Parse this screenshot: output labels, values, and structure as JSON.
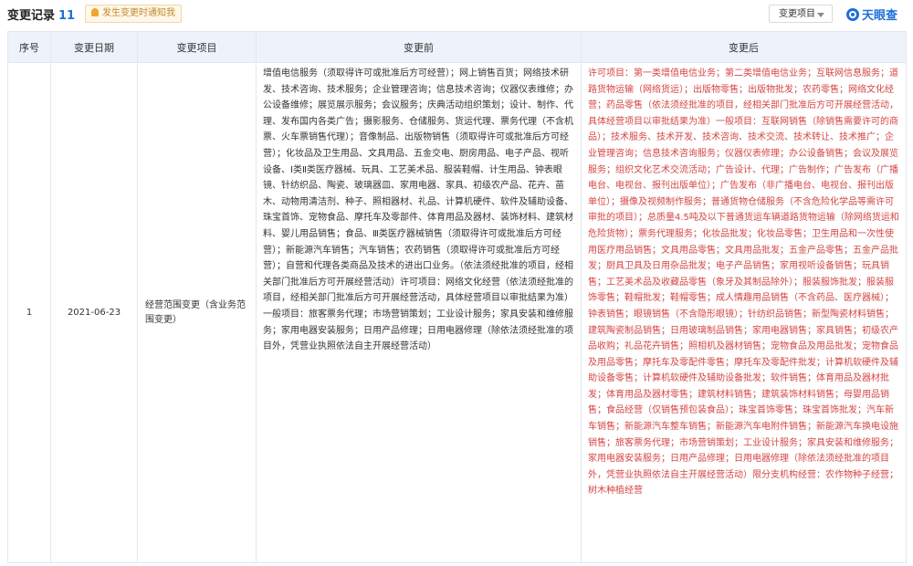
{
  "header": {
    "title": "变更记录",
    "count": "11",
    "notice": "发生变更时通知我",
    "filter_label": "变更项目",
    "brand": "天眼查"
  },
  "table": {
    "columns": [
      "序号",
      "变更日期",
      "变更项目",
      "变更前",
      "变更后"
    ],
    "rows": [
      {
        "seq": "1",
        "date": "2021-06-23",
        "item": "经营范围变更（含业务范围变更）",
        "before": "增值电信服务（须取得许可或批准后方可经营）；网上销售百货；网络技术研发、技术咨询、技术服务；企业管理咨询；信息技术咨询；仪器仪表维修；办公设备维修；展览展示服务；会议服务；庆典活动组织策划；设计、制作、代理、发布国内各类广告；摄影服务、仓储服务、货运代理、票务代理（不含机票、火车票销售代理）；音像制品、出版物销售（须取得许可或批准后方可经营）；化妆品及卫生用品、文具用品、五金交电、厨房用品、电子产品、视听设备、Ⅰ类Ⅱ类医疗器械、玩具、工艺美术品、服装鞋帽、计生用品、钟表眼镜、针纺织品、陶瓷、玻璃器皿、家用电器、家具、初级农产品、花卉、苗木、动物用清洁剂、种子、照相器材、礼品、计算机硬件、软件及辅助设备、珠宝首饰、宠物食品、摩托车及零部件、体育用品及器材、装饰材料、建筑材料、婴儿用品销售；食品、Ⅲ类医疗器械销售（须取得许可或批准后方可经营）；新能源汽车销售；汽车销售；农药销售（须取得许可或批准后方可经营）；自营和代理各类商品及技术的进出口业务。（依法须经批准的项目，经相关部门批准后方可开展经营活动）许可项目：网络文化经营（依法须经批准的项目，经相关部门批准后方可开展经营活动，具体经营项目以审批结果为准）一般项目：旅客票务代理；市场营销策划；工业设计服务；家具安装和维修服务；家用电器安装服务；日用产品修理；日用电器修理（除依法须经批准的项目外，凭营业执照依法自主开展经营活动）",
        "after": "许可项目：第一类增值电信业务；第二类增值电信业务；互联网信息服务；道路货物运输（网络货运）；出版物零售；出版物批发；农药零售；网络文化经营；药品零售（依法须经批准的项目，经相关部门批准后方可开展经营活动，具体经营项目以审批结果为准）一般项目：互联网销售（除销售需要许可的商品）；技术服务、技术开发、技术咨询、技术交流、技术转让、技术推广；企业管理咨询；信息技术咨询服务；仪器仪表修理；办公设备销售；会议及展览服务；组织文化艺术交流活动；广告设计、代理；广告制作；广告发布（广播电台、电视台、报刊出版单位）；广告发布（非广播电台、电视台、报刊出版单位）；摄像及视频制作服务；普通货物仓储服务（不含危险化学品等需许可审批的项目）；总质量4.5吨及以下普通货运车辆道路货物运输（除网络货运和危险货物）；票务代理服务；化妆品批发；化妆品零售；卫生用品和一次性使用医疗用品销售；文具用品零售；文具用品批发；五金产品零售；五金产品批发；厨具卫具及日用杂品批发；电子产品销售；家用视听设备销售；玩具销售；工艺美术品及收藏品零售（象牙及其制品除外）；服装服饰批发；服装服饰零售；鞋帽批发；鞋帽零售；成人情趣用品销售（不含药品、医疗器械）；钟表销售；眼镜销售（不含隐形眼镜）；针纺织品销售；新型陶瓷材料销售；建筑陶瓷制品销售；日用玻璃制品销售；家用电器销售；家具销售；初级农产品收购；礼品花卉销售；照相机及器材销售；宠物食品及用品批发；宠物食品及用品零售；摩托车及零配件零售；摩托车及零配件批发；计算机软硬件及辅助设备零售；计算机软硬件及辅助设备批发；软件销售；体育用品及器材批发；体育用品及器材零售；建筑材料销售；建筑装饰材料销售；母婴用品销售；食品经营（仅销售预包装食品）；珠宝首饰零售；珠宝首饰批发；汽车新车销售；新能源汽车整车销售；新能源汽车电附件销售；新能源汽车换电设施销售；旅客票务代理；市场营销策划；工业设计服务；家具安装和维修服务；家用电器安装服务；日用产品修理；日用电器修理（除依法须经批准的项目外，凭营业执照依法自主开展经营活动）限分支机构经营：农作物种子经营；树木种植经营"
      }
    ]
  },
  "colors": {
    "accent": "#1e6fd9",
    "highlight": "#d64545",
    "header_bg": "#eef3fb",
    "notice_bg": "#fff7e8"
  }
}
